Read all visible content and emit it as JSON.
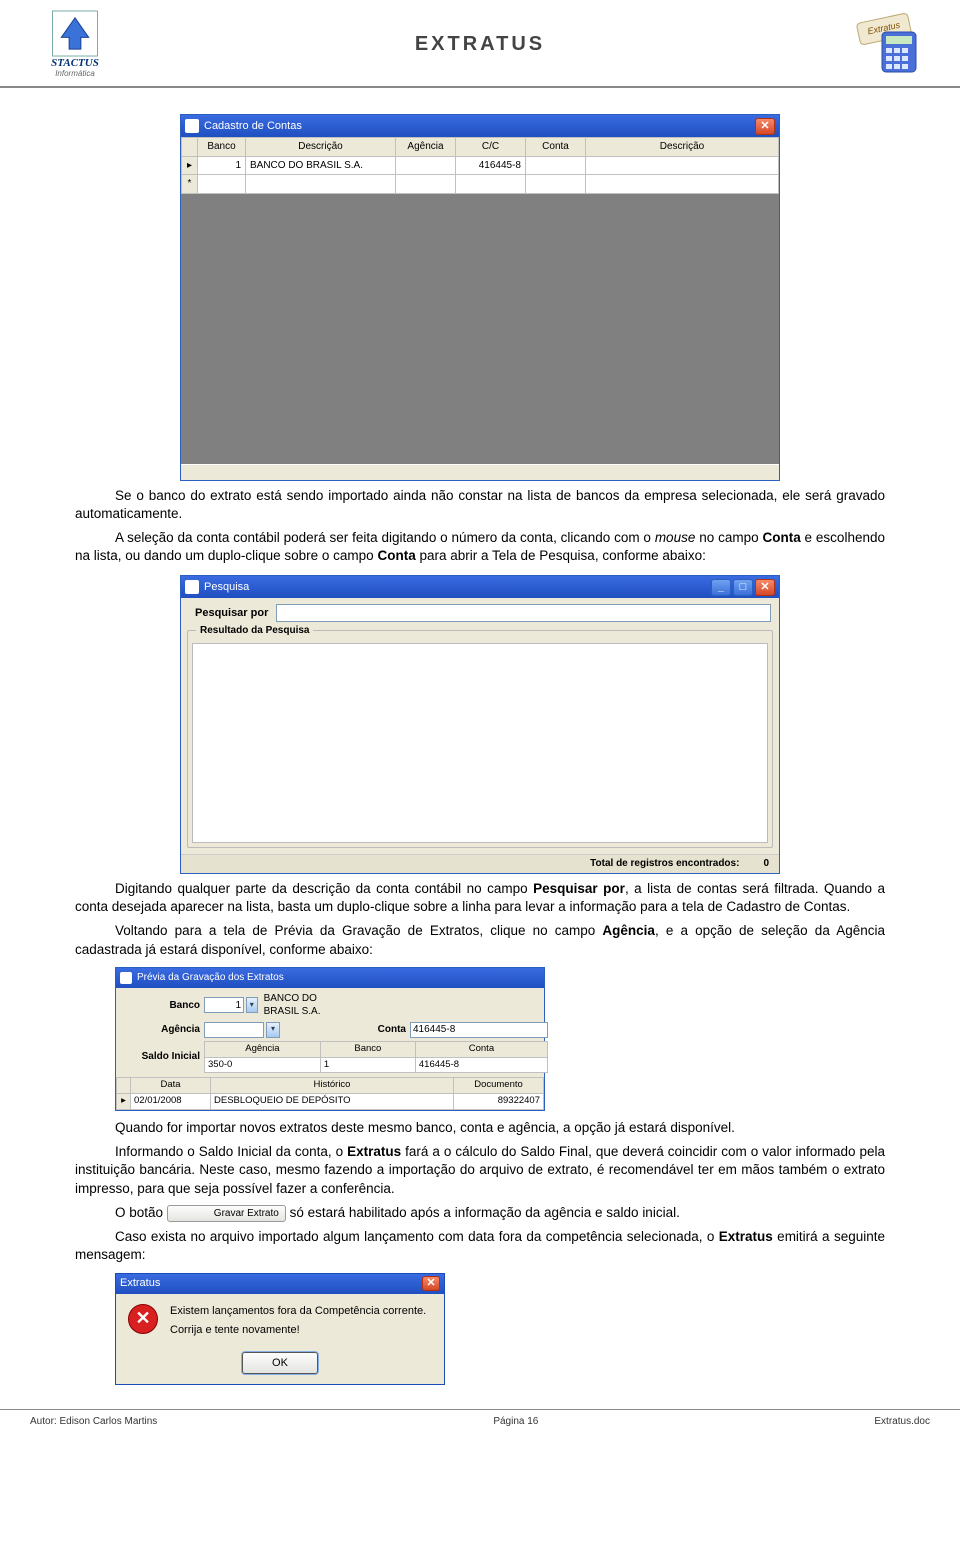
{
  "header": {
    "title": "EXTRATUS",
    "logo_text": "STACTUS",
    "logo_sub": "Informática"
  },
  "win_cadastro": {
    "title": "Cadastro de Contas",
    "cols": {
      "banco": "Banco",
      "descricao": "Descrição",
      "agencia": "Agência",
      "cc": "C/C",
      "conta": "Conta",
      "descricao2": "Descrição"
    },
    "row": {
      "banco": "1",
      "descricao": "BANCO DO BRASIL S.A.",
      "agencia": "",
      "cc": "416445-8",
      "conta": "",
      "descricao2": ""
    }
  },
  "para1": "Se o banco do extrato está sendo importado ainda não constar na lista de bancos da empresa selecionada, ele será gravado automaticamente.",
  "para2_a": "A seleção da conta contábil poderá ser feita digitando o número da conta, clicando com o ",
  "para2_mouse": "mouse",
  "para2_b": " no campo ",
  "para2_conta": "Conta",
  "para2_c": " e escolhendo na lista, ou dando um duplo-clique sobre o campo ",
  "para2_conta2": "Conta",
  "para2_d": " para abrir a Tela de Pesquisa, conforme abaixo:",
  "win_pesquisa": {
    "title": "Pesquisa",
    "pesquisar_label": "Pesquisar por",
    "group": "Resultado da Pesquisa",
    "footer_label": "Total de registros encontrados:",
    "footer_value": "0"
  },
  "para3_a": "Digitando qualquer parte da descrição da conta contábil no campo ",
  "para3_field": "Pesquisar por",
  "para3_b": ", a lista de contas será filtrada. Quando a conta desejada aparecer na lista, basta um duplo-clique sobre a linha para levar a informação para a tela de Cadastro de Contas.",
  "para4_a": "Voltando para a tela de Prévia da Gravação de Extratos, clique no campo ",
  "para4_field": "Agência",
  "para4_b": ", e a opção de seleção da Agência cadastrada já estará disponível, conforme abaixo:",
  "win_previa": {
    "title": "Prévia da Gravação dos Extratos",
    "lbl_banco": "Banco",
    "banco_num": "1",
    "banco_desc": "BANCO DO BRASIL S.A.",
    "lbl_agencia": "Agência",
    "lbl_conta": "Conta",
    "conta_val": "416445-8",
    "lbl_saldo": "Saldo Inicial",
    "sub_cols": {
      "agencia": "Agência",
      "banco": "Banco",
      "conta": "Conta"
    },
    "sub_row": {
      "agencia": "350-0",
      "banco": "1",
      "conta": "416445-8"
    },
    "data_cols": {
      "data": "Data",
      "historico": "Histórico",
      "documento": "Documento"
    },
    "data_row": {
      "data": "02/01/2008",
      "historico": "DESBLOQUEIO DE DEPÓSITO",
      "documento": "89322407"
    }
  },
  "para5": "Quando for importar novos extratos deste mesmo banco, conta e agência, a opção já estará disponível.",
  "para6_a": "Informando o Saldo Inicial da conta, o ",
  "para6_bold": "Extratus",
  "para6_b": " fará a o cálculo do Saldo Final, que deverá coincidir com o valor informado pela instituição bancária. Neste caso, mesmo fazendo a importação do arquivo de extrato, é recomendável ter em mãos também o extrato impresso, para que seja possível fazer a conferência.",
  "para7_a": "O botão ",
  "btn_gravar": "Gravar Extrato",
  "para7_b": " só estará habilitado após a informação da agência e saldo inicial.",
  "para8_a": "Caso exista no arquivo importado algum lançamento com data fora da competência selecionada, o ",
  "para8_bold": "Extratus",
  "para8_b": " emitirá a seguinte mensagem:",
  "win_msg": {
    "title": "Extratus",
    "line1": "Existem lançamentos fora da Competência corrente.",
    "line2": "Corrija e tente novamente!",
    "ok": "OK"
  },
  "footer": {
    "author": "Autor: Edison Carlos Martins",
    "page": "Página 16",
    "doc": "Extratus.doc"
  }
}
